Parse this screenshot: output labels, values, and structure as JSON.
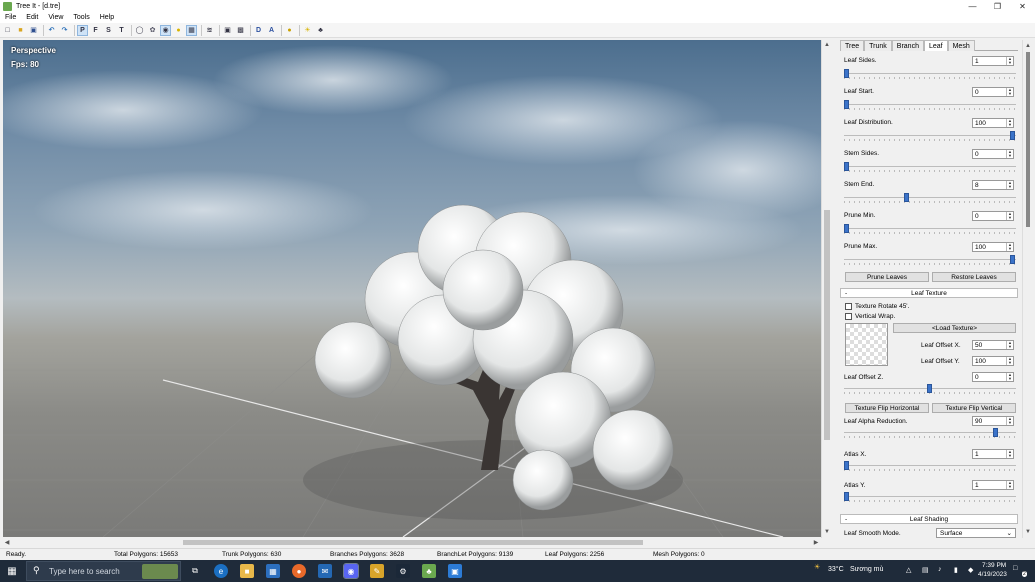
{
  "window": {
    "title": "Tree It - [d.tre]"
  },
  "menu": [
    "File",
    "Edit",
    "View",
    "Tools",
    "Help"
  ],
  "toolbar": {
    "letters": {
      "p": "P",
      "f": "F",
      "s": "S",
      "t": "T",
      "d": "D",
      "a": "A"
    }
  },
  "viewport": {
    "mode": "Perspective",
    "fps": "Fps: 80"
  },
  "panel": {
    "tabs": [
      "Tree",
      "Trunk",
      "Branch",
      "Leaf",
      "Mesh"
    ],
    "active_tab": "Leaf",
    "params": [
      {
        "label": "Leaf Sides.",
        "value": "1",
        "slider": 0.0
      },
      {
        "label": "Leaf Start.",
        "value": "0",
        "slider": 0.0
      },
      {
        "label": "Leaf Distribution.",
        "value": "100",
        "slider": 1.0
      },
      {
        "label": "Stem Sides.",
        "value": "0",
        "slider": 0.0
      },
      {
        "label": "Stem End.",
        "value": "8",
        "slider": 0.36
      },
      {
        "label": "Prune Min.",
        "value": "0",
        "slider": 0.0
      },
      {
        "label": "Prune Max.",
        "value": "100",
        "slider": 1.0
      }
    ],
    "prune_leaves": "Prune Leaves",
    "restore_leaves": "Restore Leaves",
    "texture_section": "Leaf Texture",
    "collapse_symbol": "-",
    "texture_rotate": "Texture Rotate 45'.",
    "vertical_wrap": "Vertical Wrap.",
    "load_texture": "<Load Texture>",
    "offset_x": {
      "label": "Leaf Offset X.",
      "value": "50"
    },
    "offset_y": {
      "label": "Leaf Offset Y.",
      "value": "100"
    },
    "offset_z": {
      "label": "Leaf Offset Z.",
      "value": "0",
      "slider": 0.5
    },
    "flip_h": "Texture Flip Horizontal",
    "flip_v": "Texture Flip Vertical",
    "alpha": {
      "label": "Leaf Alpha Reduction.",
      "value": "90",
      "slider": 0.9
    },
    "atlas_x": {
      "label": "Atlas X.",
      "value": "1",
      "slider": 0.0
    },
    "atlas_y": {
      "label": "Atlas Y.",
      "value": "1",
      "slider": 0.0
    },
    "shading_section": "Leaf Shading",
    "smooth_mode": {
      "label": "Leaf Smooth Mode.",
      "value": "Surface"
    },
    "dropdown_symbol": "⌄"
  },
  "status": {
    "ready": "Ready.",
    "total": "Total Polygons: 15653",
    "trunk": "Trunk Polygons: 630",
    "branches": "Branches Polygons: 3628",
    "branchlet": "BranchLet Polygons: 9139",
    "leaf": "Leaf Polygons: 2256",
    "mesh": "Mesh Polygons: 0"
  },
  "taskbar": {
    "search_placeholder": "Type here to search",
    "weather": "33°C",
    "weather_desc": "Sương mù",
    "time": "7:39 PM",
    "date": "4/19/2023",
    "notification_count": "2"
  },
  "colors": {
    "slider_thumb": "#3b73c9",
    "taskbar": "#1f2b3a",
    "titlebar_bg": "#ffffff"
  }
}
